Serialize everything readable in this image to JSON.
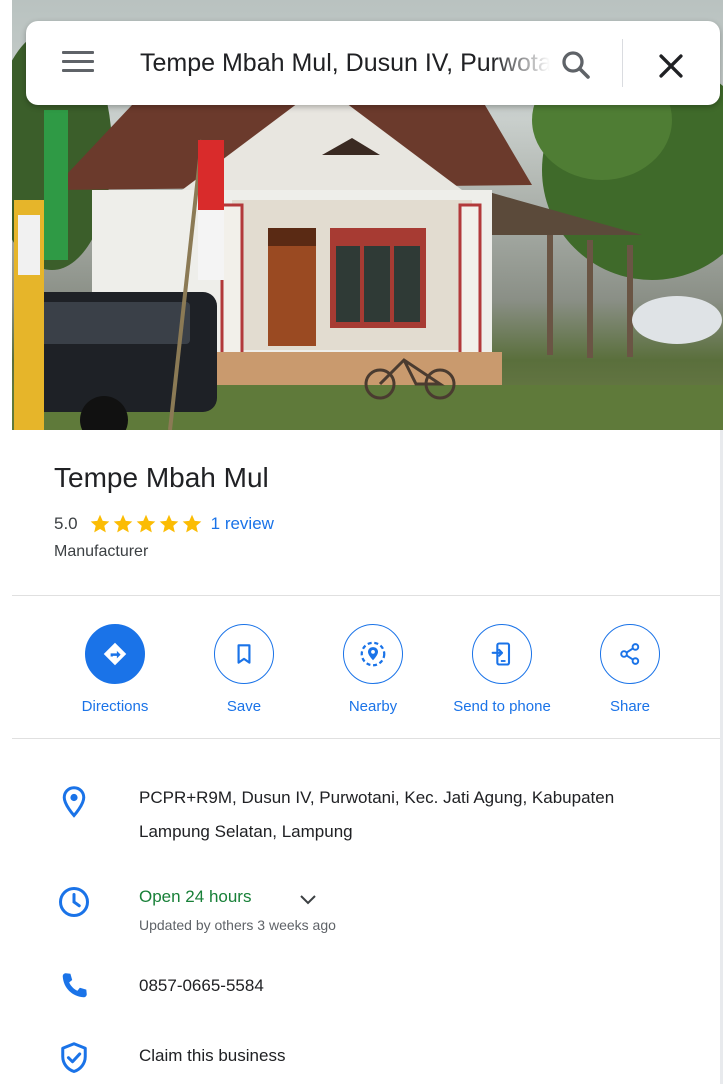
{
  "search": {
    "query": "Tempe Mbah Mul, Dusun IV, Purwotani",
    "icons": {
      "menu": "menu-icon",
      "search": "search-icon",
      "close": "close-icon"
    }
  },
  "place": {
    "name": "Tempe Mbah Mul",
    "rating": "5.0",
    "stars": 5,
    "reviews": "1 review",
    "category": "Manufacturer"
  },
  "actions": [
    {
      "label": "Directions",
      "icon": "directions-icon"
    },
    {
      "label": "Save",
      "icon": "bookmark-icon"
    },
    {
      "label": "Nearby",
      "icon": "nearby-icon"
    },
    {
      "label": "Send to phone",
      "icon": "send-to-phone-icon"
    },
    {
      "label": "Share",
      "icon": "share-icon"
    }
  ],
  "info": {
    "address_line1": "PCPR+R9M, Dusun IV, Purwotani, Kec. Jati Agung, Kabupaten",
    "address_line2": "Lampung Selatan, Lampung",
    "hours": "Open 24 hours",
    "hours_updated": "Updated by others 3 weeks ago",
    "phone": "0857-0665-5584",
    "claim": "Claim this business"
  },
  "colors": {
    "accent": "#1a73e8",
    "star": "#fbbc04",
    "open": "#188038",
    "text": "#202124",
    "secondary": "#5f6368"
  }
}
